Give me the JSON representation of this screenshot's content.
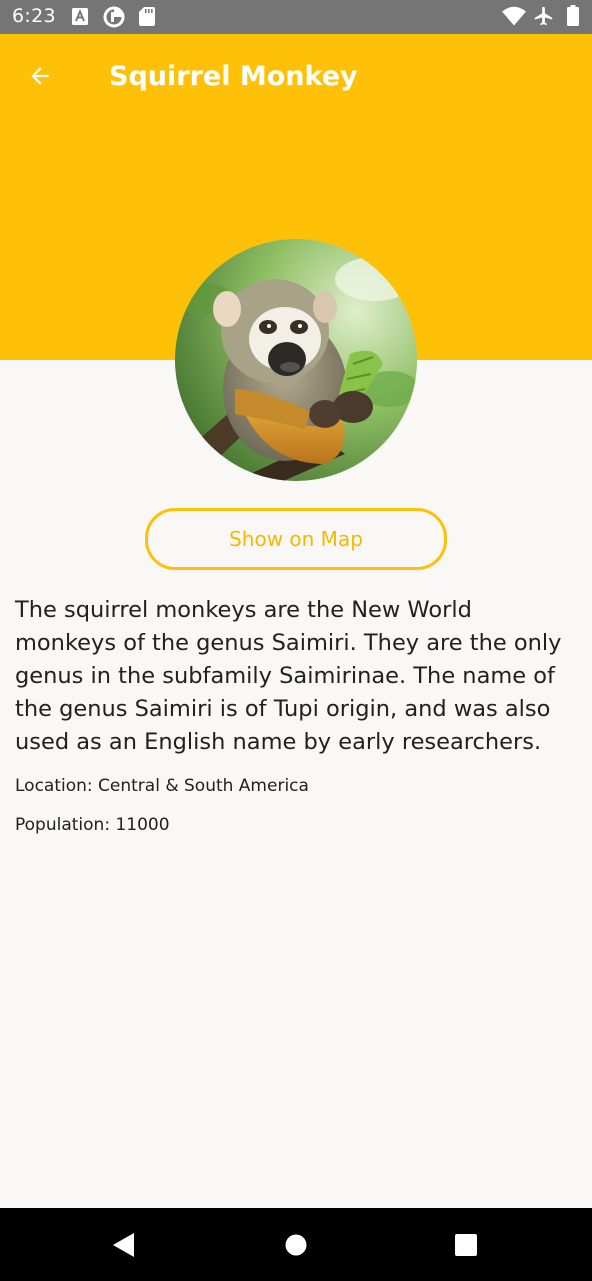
{
  "status_bar": {
    "time": "6:23",
    "icons": [
      "keyboard-a-icon",
      "data-saver-icon",
      "sd-card-icon",
      "wifi-icon",
      "airplane-mode-icon",
      "battery-icon"
    ]
  },
  "header": {
    "title": "Squirrel Monkey",
    "back_icon": "arrow-back-icon",
    "background_color": "#ffc107"
  },
  "actions": {
    "show_on_map_label": "Show on Map",
    "accent_color": "#ffc107"
  },
  "content": {
    "description": "The squirrel monkeys are the New World monkeys of the genus Saimiri. They are the only genus in the subfamily Saimirinae. The name of the genus Saimiri is of Tupi origin, and was also used as an English name by early researchers.",
    "location": "Location: Central & South America",
    "population": "Population: 11000"
  },
  "nav_bar": {
    "icons": [
      "back-triangle-icon",
      "home-circle-icon",
      "recents-square-icon"
    ]
  }
}
